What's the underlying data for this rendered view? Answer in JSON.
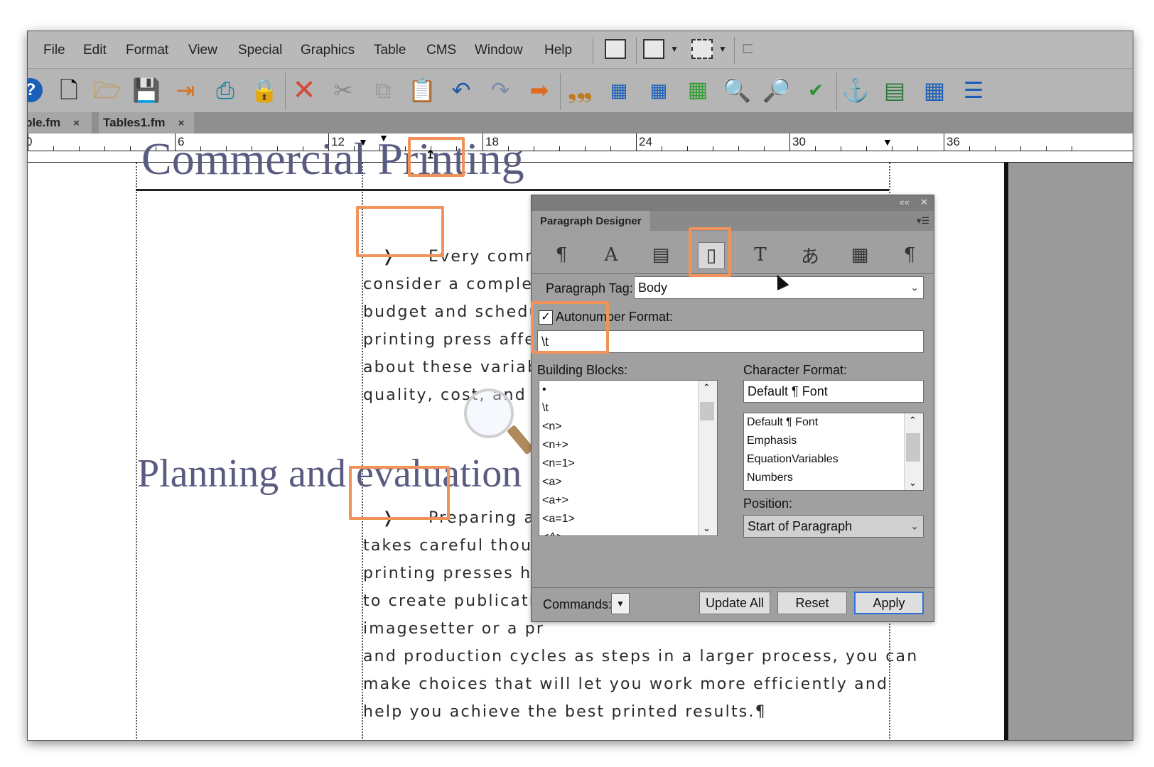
{
  "menubar": {
    "items": [
      "File",
      "Edit",
      "Format",
      "View",
      "Special",
      "Graphics",
      "Table",
      "CMS",
      "Window",
      "Help"
    ]
  },
  "toolbar": {
    "icons": [
      "help-icon",
      "new-document-icon",
      "open-folder-icon",
      "save-icon",
      "import-icon",
      "print-icon",
      "lock-icon",
      "delete-icon",
      "cut-icon",
      "copy-icon",
      "paste-icon",
      "undo-icon",
      "redo-icon",
      "forward-icon",
      "smart-quotes-icon",
      "character-designer-icon",
      "paragraph-designer-icon",
      "table-designer-icon",
      "find-icon",
      "search-icon",
      "spell-check-icon",
      "anchor-icon",
      "marker-icon",
      "table-icon",
      "variables-icon"
    ]
  },
  "tabs": [
    {
      "label": "ple.fm",
      "close": "×"
    },
    {
      "label": "Tables1.fm",
      "close": "×"
    }
  ],
  "ruler": {
    "numbers": [
      "0",
      "6",
      "12",
      "18",
      "24",
      "30",
      "36"
    ]
  },
  "document": {
    "head1": "Commercial Printing",
    "para1": [
      "Every comm",
      "consider a complex",
      "budget and schedu",
      "printing press affec",
      "about these variabl",
      "quality, cost, and s"
    ],
    "head2": "Planning and evaluation",
    "para2": [
      "Preparing a",
      "takes careful thoug",
      "printing presses ha",
      "to create publicatio",
      "imagesetter or a pr",
      "and production cycles as steps in a larger process, you can",
      "make choices that will let you work more efficiently and",
      "help you achieve the best printed results.¶"
    ],
    "tab_glyph": "❭"
  },
  "dialog": {
    "title": "Paragraph Designer",
    "collapse": "««",
    "close": "✕",
    "menu": "▾☰",
    "tab_icons": [
      "¶",
      "A",
      "▤",
      "▯",
      "T",
      "あ",
      "▦",
      "¶"
    ],
    "paragraph_tag_label": "Paragraph Tag:",
    "paragraph_tag_value": "Body",
    "autonumber_label": "Autonumber Format:",
    "autonumber_checked": true,
    "autonumber_value": "\\t",
    "building_blocks_label": "Building Blocks:",
    "building_blocks": [
      "•",
      "\\t",
      "<n>",
      "<n+>",
      "<n=1>",
      "<a>",
      "<a+>",
      "<a=1>",
      "<A>"
    ],
    "character_format_label": "Character Format:",
    "character_format_value": "Default ¶ Font",
    "character_formats": [
      "Default ¶ Font",
      "Emphasis",
      "EquationVariables",
      "Numbers"
    ],
    "position_label": "Position:",
    "position_value": "Start of Paragraph",
    "commands_label": "Commands:",
    "buttons": {
      "update_all": "Update All",
      "reset": "Reset",
      "apply": "Apply"
    }
  },
  "colors": {
    "highlight": "#f0925a",
    "heading": "#5a5b80",
    "apply_border": "#2f6fd8"
  }
}
